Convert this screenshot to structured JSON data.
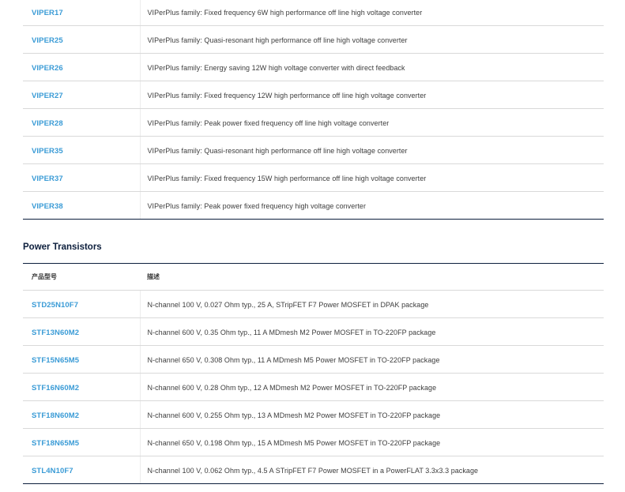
{
  "viper_table": {
    "rows": [
      {
        "part": "VIPER17",
        "desc": "VIPerPlus family: Fixed frequency 6W high performance off line high voltage converter"
      },
      {
        "part": "VIPER25",
        "desc": "VIPerPlus family: Quasi-resonant high performance off line high voltage converter"
      },
      {
        "part": "VIPER26",
        "desc": "VIPerPlus family: Energy saving 12W high voltage converter with direct feedback"
      },
      {
        "part": "VIPER27",
        "desc": "VIPerPlus family: Fixed frequency 12W high performance off line high voltage converter"
      },
      {
        "part": "VIPER28",
        "desc": "VIPerPlus family: Peak power fixed frequency off line high voltage converter"
      },
      {
        "part": "VIPER35",
        "desc": "VIPerPlus family: Quasi-resonant high performance off line high voltage converter"
      },
      {
        "part": "VIPER37",
        "desc": "VIPerPlus family: Fixed frequency 15W high performance off line high voltage converter"
      },
      {
        "part": "VIPER38",
        "desc": "VIPerPlus family: Peak power fixed frequency high voltage converter"
      }
    ]
  },
  "power_transistors": {
    "title": "Power Transistors",
    "headers": {
      "part": "产品型号",
      "desc": "描述"
    },
    "rows": [
      {
        "part": "STD25N10F7",
        "desc": "N-channel 100 V, 0.027 Ohm typ., 25 A, STripFET F7 Power MOSFET in DPAK package"
      },
      {
        "part": "STF13N60M2",
        "desc": "N-channel 600 V, 0.35 Ohm typ., 11 A MDmesh M2 Power MOSFET in TO-220FP package"
      },
      {
        "part": "STF15N65M5",
        "desc": "N-channel 650 V, 0.308 Ohm typ., 11 A MDmesh M5 Power MOSFET in TO-220FP package"
      },
      {
        "part": "STF16N60M2",
        "desc": "N-channel 600 V, 0.28 Ohm typ., 12 A MDmesh M2 Power MOSFET in TO-220FP package"
      },
      {
        "part": "STF18N60M2",
        "desc": "N-channel 600 V, 0.255 Ohm typ., 13 A MDmesh M2 Power MOSFET in TO-220FP package"
      },
      {
        "part": "STF18N65M5",
        "desc": "N-channel 650 V, 0.198 Ohm typ., 15 A MDmesh M5 Power MOSFET in TO-220FP package"
      },
      {
        "part": "STL4N10F7",
        "desc": "N-channel 100 V, 0.062 Ohm typ., 4.5 A STripFET F7 Power MOSFET in a PowerFLAT 3.3x3.3 package"
      }
    ]
  },
  "colors": {
    "link": "#3a9bd6",
    "heading": "#0c1e3c",
    "divider": "#d9d9d9"
  }
}
